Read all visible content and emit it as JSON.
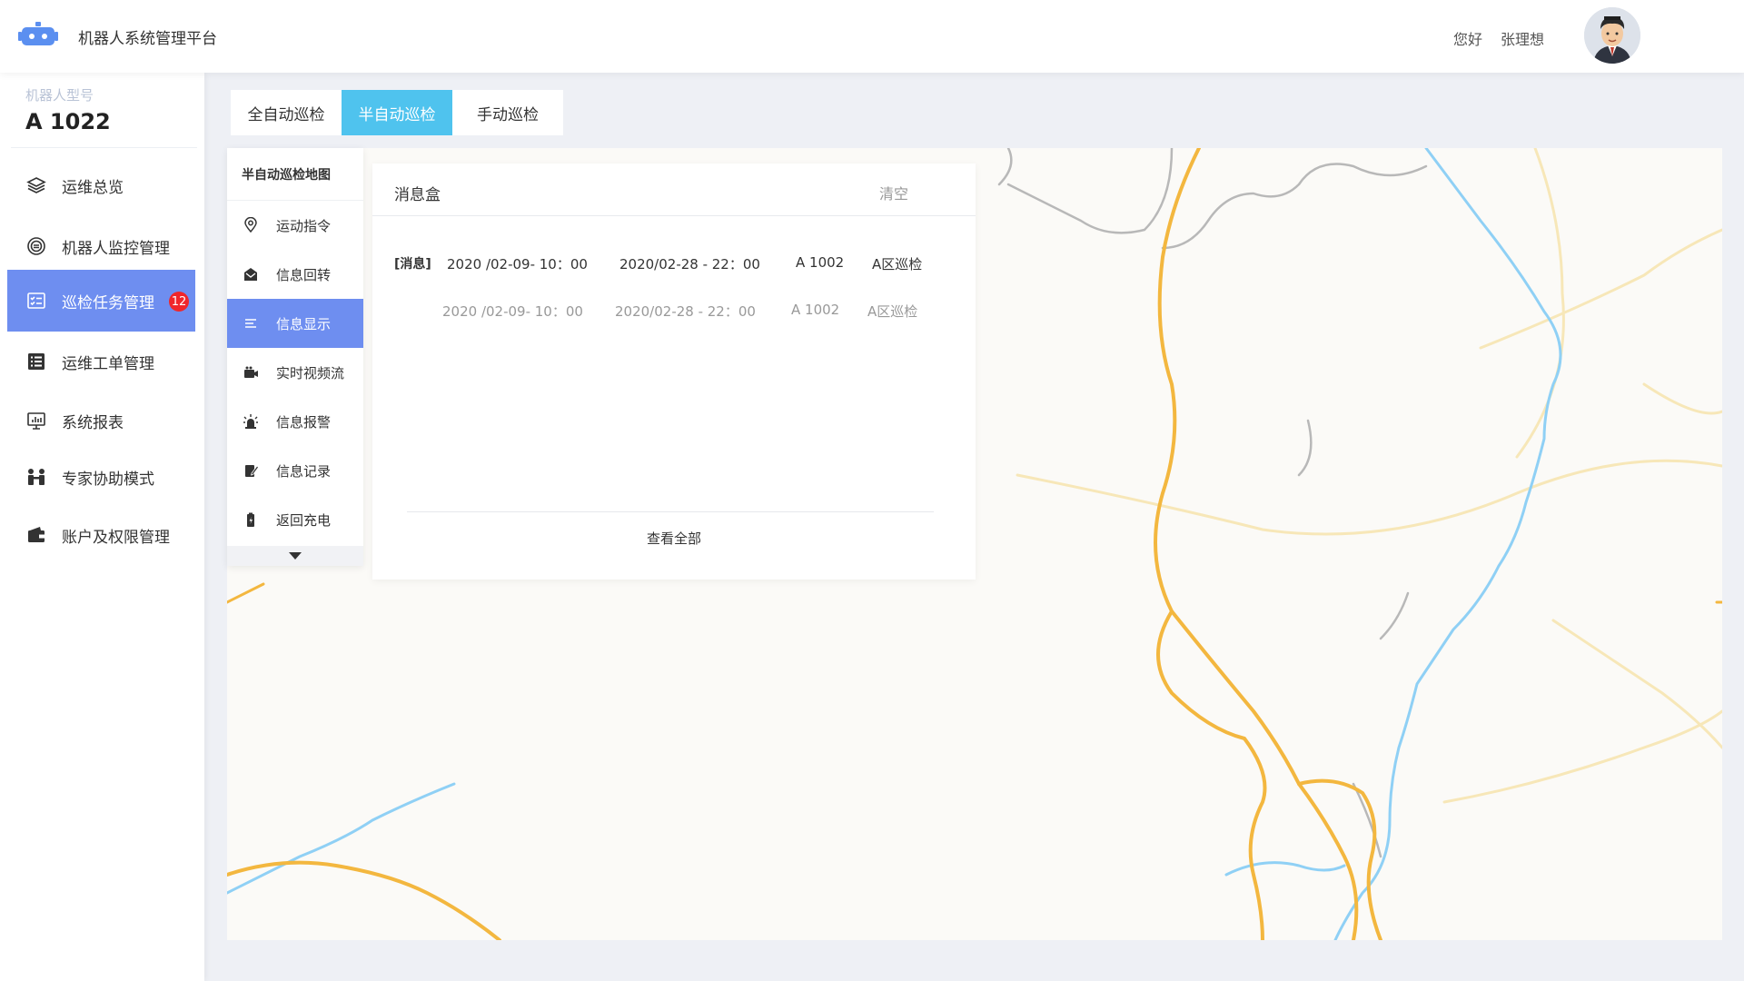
{
  "header": {
    "logo_icon": "robot-icon",
    "title": "机器人系统管理平台",
    "greeting": "您好",
    "username": "张理想",
    "avatar_icon": "user-avatar"
  },
  "sidebar": {
    "model_label": "机器人型号",
    "model_value": "A 1022",
    "items": [
      {
        "label": "运维总览",
        "icon": "layers-icon"
      },
      {
        "label": "机器人监控管理",
        "icon": "monitor-robot-icon"
      },
      {
        "label": "巡检任务管理",
        "icon": "checklist-icon",
        "badge": "12",
        "active": true
      },
      {
        "label": "运维工单管理",
        "icon": "work-order-icon"
      },
      {
        "label": "系统报表",
        "icon": "report-icon"
      },
      {
        "label": "专家协助模式",
        "icon": "expert-icon"
      },
      {
        "label": "账户及权限管理",
        "icon": "wallet-icon"
      }
    ]
  },
  "tabs": [
    {
      "label": "全自动巡检"
    },
    {
      "label": "半自动巡检",
      "active": true
    },
    {
      "label": "手动巡检"
    }
  ],
  "func_panel": {
    "title": "半自动巡检地图",
    "items": [
      {
        "label": "运动指令",
        "icon": "location-icon"
      },
      {
        "label": "信息回转",
        "icon": "mail-open-icon"
      },
      {
        "label": "信息显示",
        "icon": "list-icon",
        "active": true
      },
      {
        "label": "实时视频流",
        "icon": "camera-icon"
      },
      {
        "label": "信息报警",
        "icon": "alarm-icon"
      },
      {
        "label": "信息记录",
        "icon": "note-icon"
      },
      {
        "label": "返回充电",
        "icon": "battery-icon"
      }
    ],
    "more_icon": "chevron-down-icon"
  },
  "message_box": {
    "title": "消息盒",
    "clear_label": "清空",
    "messages": [
      {
        "tag": "[消息]",
        "start": "2020 /02-09- 10：00",
        "end": "2020/02-28 - 22：00",
        "robot": "A 1002",
        "task": "A区巡检"
      },
      {
        "tag": "",
        "start": "2020 /02-09- 10：00",
        "end": "2020/02-28 - 22：00",
        "robot": "A 1002",
        "task": "A区巡检"
      }
    ],
    "view_all_label": "查看全部"
  },
  "colors": {
    "primary": "#6e8ef0",
    "tab_active": "#4fc3ee",
    "badge": "#f0262a",
    "road_major": "#f3b73f",
    "river": "#8fd0f5"
  }
}
